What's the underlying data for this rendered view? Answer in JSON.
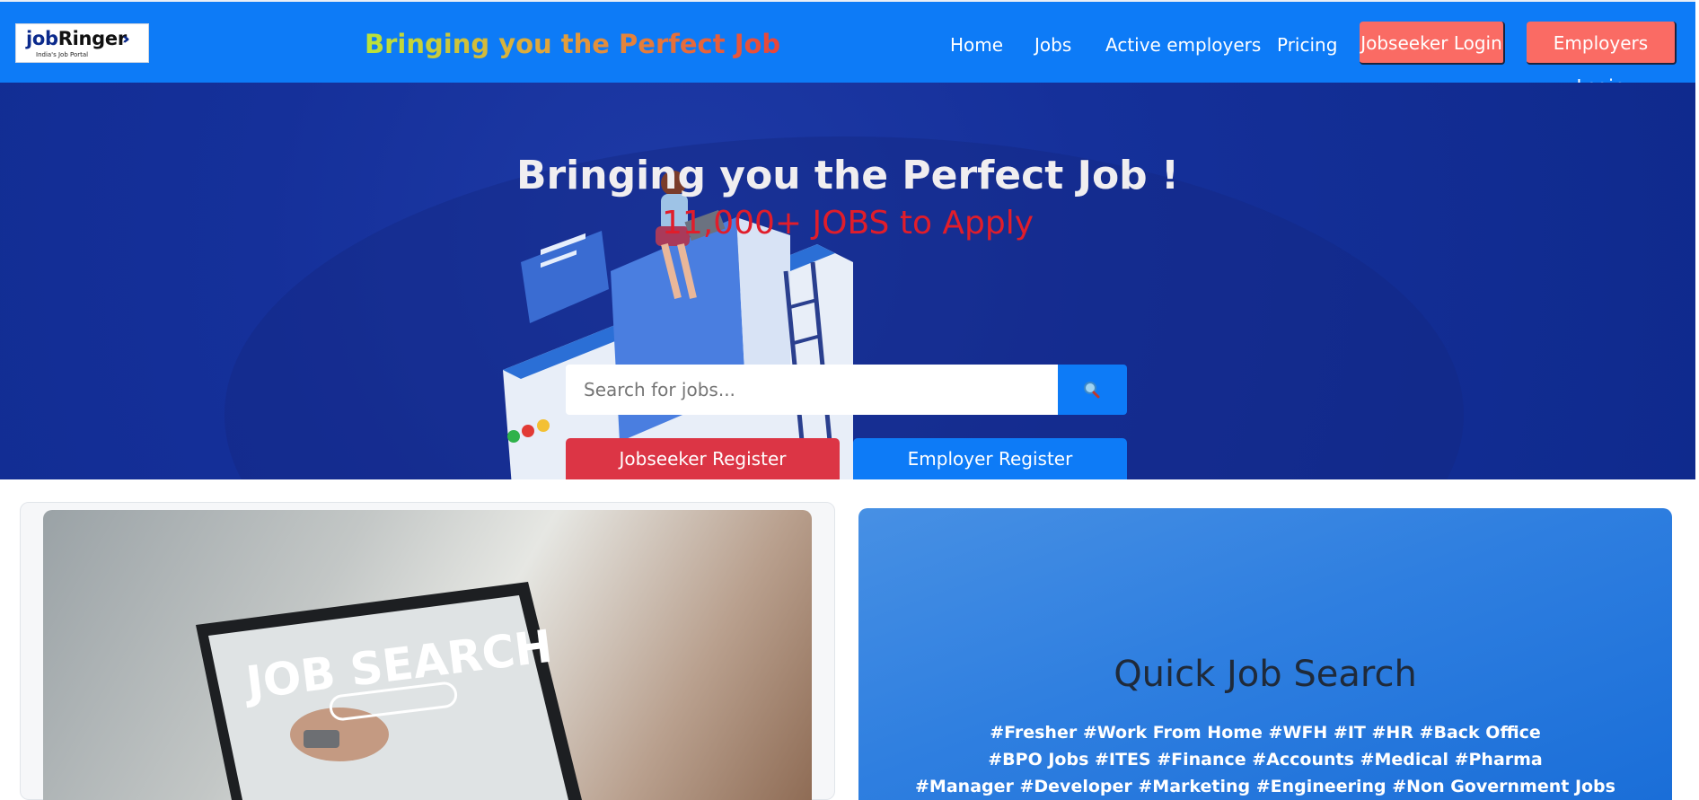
{
  "header": {
    "logo": {
      "brand_part1": "job",
      "brand_part2": "Ringer",
      "tagline_small": "India's Job Portal"
    },
    "tagline": "Bringing you the Perfect Job",
    "nav": [
      {
        "label": "Home"
      },
      {
        "label": "Jobs"
      },
      {
        "label": "Active employers"
      },
      {
        "label": "Pricing"
      }
    ],
    "jobseeker_login": "Jobseeker Login",
    "employers_login": "Employers Login"
  },
  "hero": {
    "title": "Bringing you the Perfect Job !",
    "subtitle": "11,000+ JOBS to Apply",
    "search": {
      "placeholder": "Search for jobs...",
      "button_icon": "magnifier-icon"
    },
    "jobseeker_register": "Jobseeker Register",
    "employer_register": "Employer Register"
  },
  "left_card": {
    "image_text": "JOB SEARCH"
  },
  "quick_search": {
    "title": "Quick Job Search",
    "tags_lines": [
      "#Fresher #Work From Home #WFH #IT #HR  #Back Office",
      "#BPO Jobs #ITES #Finance #Accounts #Medical  #Pharma",
      "#Manager #Developer #Marketing #Engineering #Non Government Jobs"
    ]
  },
  "colors": {
    "navbar": "#0d7bf7",
    "login_button": "#fa6b64",
    "hero_bg": "#15309a",
    "subtitle_red": "#e11d2a",
    "jobseeker_register": "#dc3545",
    "employer_register": "#0d7bf7",
    "quick_search_bg": "#2f7fe0"
  }
}
